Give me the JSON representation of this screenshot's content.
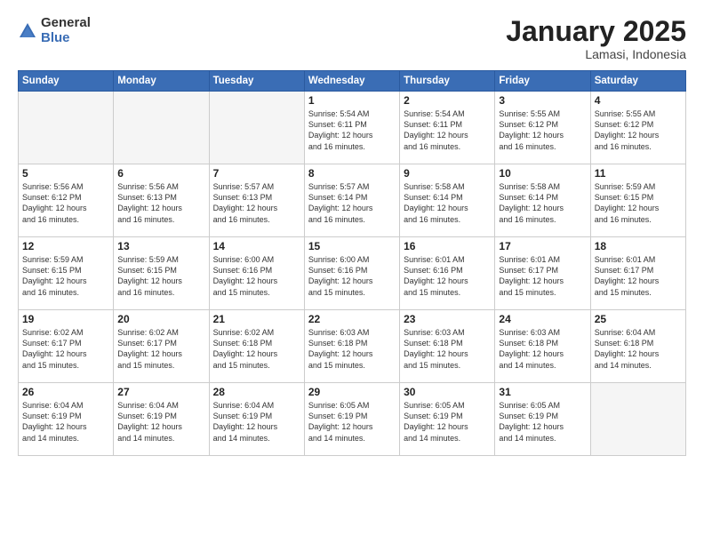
{
  "logo": {
    "general": "General",
    "blue": "Blue"
  },
  "title": "January 2025",
  "subtitle": "Lamasi, Indonesia",
  "weekdays": [
    "Sunday",
    "Monday",
    "Tuesday",
    "Wednesday",
    "Thursday",
    "Friday",
    "Saturday"
  ],
  "weeks": [
    [
      {
        "day": "",
        "info": ""
      },
      {
        "day": "",
        "info": ""
      },
      {
        "day": "",
        "info": ""
      },
      {
        "day": "1",
        "info": "Sunrise: 5:54 AM\nSunset: 6:11 PM\nDaylight: 12 hours\nand 16 minutes."
      },
      {
        "day": "2",
        "info": "Sunrise: 5:54 AM\nSunset: 6:11 PM\nDaylight: 12 hours\nand 16 minutes."
      },
      {
        "day": "3",
        "info": "Sunrise: 5:55 AM\nSunset: 6:12 PM\nDaylight: 12 hours\nand 16 minutes."
      },
      {
        "day": "4",
        "info": "Sunrise: 5:55 AM\nSunset: 6:12 PM\nDaylight: 12 hours\nand 16 minutes."
      }
    ],
    [
      {
        "day": "5",
        "info": "Sunrise: 5:56 AM\nSunset: 6:12 PM\nDaylight: 12 hours\nand 16 minutes."
      },
      {
        "day": "6",
        "info": "Sunrise: 5:56 AM\nSunset: 6:13 PM\nDaylight: 12 hours\nand 16 minutes."
      },
      {
        "day": "7",
        "info": "Sunrise: 5:57 AM\nSunset: 6:13 PM\nDaylight: 12 hours\nand 16 minutes."
      },
      {
        "day": "8",
        "info": "Sunrise: 5:57 AM\nSunset: 6:14 PM\nDaylight: 12 hours\nand 16 minutes."
      },
      {
        "day": "9",
        "info": "Sunrise: 5:58 AM\nSunset: 6:14 PM\nDaylight: 12 hours\nand 16 minutes."
      },
      {
        "day": "10",
        "info": "Sunrise: 5:58 AM\nSunset: 6:14 PM\nDaylight: 12 hours\nand 16 minutes."
      },
      {
        "day": "11",
        "info": "Sunrise: 5:59 AM\nSunset: 6:15 PM\nDaylight: 12 hours\nand 16 minutes."
      }
    ],
    [
      {
        "day": "12",
        "info": "Sunrise: 5:59 AM\nSunset: 6:15 PM\nDaylight: 12 hours\nand 16 minutes."
      },
      {
        "day": "13",
        "info": "Sunrise: 5:59 AM\nSunset: 6:15 PM\nDaylight: 12 hours\nand 16 minutes."
      },
      {
        "day": "14",
        "info": "Sunrise: 6:00 AM\nSunset: 6:16 PM\nDaylight: 12 hours\nand 15 minutes."
      },
      {
        "day": "15",
        "info": "Sunrise: 6:00 AM\nSunset: 6:16 PM\nDaylight: 12 hours\nand 15 minutes."
      },
      {
        "day": "16",
        "info": "Sunrise: 6:01 AM\nSunset: 6:16 PM\nDaylight: 12 hours\nand 15 minutes."
      },
      {
        "day": "17",
        "info": "Sunrise: 6:01 AM\nSunset: 6:17 PM\nDaylight: 12 hours\nand 15 minutes."
      },
      {
        "day": "18",
        "info": "Sunrise: 6:01 AM\nSunset: 6:17 PM\nDaylight: 12 hours\nand 15 minutes."
      }
    ],
    [
      {
        "day": "19",
        "info": "Sunrise: 6:02 AM\nSunset: 6:17 PM\nDaylight: 12 hours\nand 15 minutes."
      },
      {
        "day": "20",
        "info": "Sunrise: 6:02 AM\nSunset: 6:17 PM\nDaylight: 12 hours\nand 15 minutes."
      },
      {
        "day": "21",
        "info": "Sunrise: 6:02 AM\nSunset: 6:18 PM\nDaylight: 12 hours\nand 15 minutes."
      },
      {
        "day": "22",
        "info": "Sunrise: 6:03 AM\nSunset: 6:18 PM\nDaylight: 12 hours\nand 15 minutes."
      },
      {
        "day": "23",
        "info": "Sunrise: 6:03 AM\nSunset: 6:18 PM\nDaylight: 12 hours\nand 15 minutes."
      },
      {
        "day": "24",
        "info": "Sunrise: 6:03 AM\nSunset: 6:18 PM\nDaylight: 12 hours\nand 14 minutes."
      },
      {
        "day": "25",
        "info": "Sunrise: 6:04 AM\nSunset: 6:18 PM\nDaylight: 12 hours\nand 14 minutes."
      }
    ],
    [
      {
        "day": "26",
        "info": "Sunrise: 6:04 AM\nSunset: 6:19 PM\nDaylight: 12 hours\nand 14 minutes."
      },
      {
        "day": "27",
        "info": "Sunrise: 6:04 AM\nSunset: 6:19 PM\nDaylight: 12 hours\nand 14 minutes."
      },
      {
        "day": "28",
        "info": "Sunrise: 6:04 AM\nSunset: 6:19 PM\nDaylight: 12 hours\nand 14 minutes."
      },
      {
        "day": "29",
        "info": "Sunrise: 6:05 AM\nSunset: 6:19 PM\nDaylight: 12 hours\nand 14 minutes."
      },
      {
        "day": "30",
        "info": "Sunrise: 6:05 AM\nSunset: 6:19 PM\nDaylight: 12 hours\nand 14 minutes."
      },
      {
        "day": "31",
        "info": "Sunrise: 6:05 AM\nSunset: 6:19 PM\nDaylight: 12 hours\nand 14 minutes."
      },
      {
        "day": "",
        "info": ""
      }
    ]
  ]
}
